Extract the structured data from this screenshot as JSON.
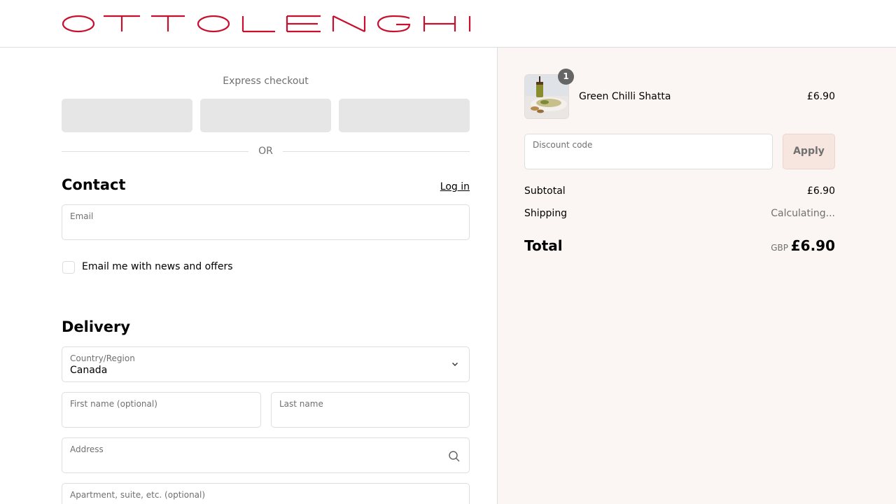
{
  "brand": {
    "name": "OTTOLENGHI",
    "color": "#c8102e"
  },
  "express": {
    "title": "Express checkout",
    "or_label": "OR"
  },
  "contact": {
    "title": "Contact",
    "login_label": "Log in",
    "email_label": "Email",
    "email_value": "",
    "newsletter_label": "Email me with news and offers",
    "newsletter_checked": false
  },
  "delivery": {
    "title": "Delivery",
    "country_label": "Country/Region",
    "country_value": "Canada",
    "first_name_label": "First name (optional)",
    "last_name_label": "Last name",
    "address_label": "Address",
    "apartment_label": "Apartment, suite, etc. (optional)"
  },
  "summary": {
    "item": {
      "name": "Green Chilli Shatta",
      "price": "£6.90",
      "quantity": "1"
    },
    "discount_label": "Discount code",
    "apply_label": "Apply",
    "subtotal_label": "Subtotal",
    "subtotal_value": "£6.90",
    "shipping_label": "Shipping",
    "shipping_value": "Calculating...",
    "total_label": "Total",
    "total_currency": "GBP",
    "total_value": "£6.90"
  },
  "colors": {
    "summary_bg": "#fbf6f3",
    "apply_bg": "#f7e6df",
    "badge_bg": "#666666"
  }
}
